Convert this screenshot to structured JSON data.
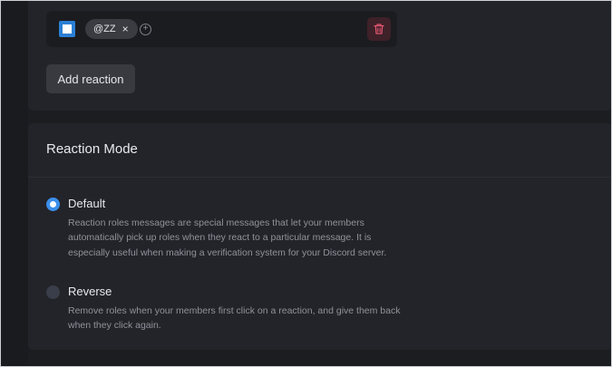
{
  "reaction": {
    "emoji_icon": "blue-square-emoji",
    "role_label": "@ZZ",
    "remove_role_glyph": "×",
    "add_role_glyph": "+",
    "delete_icon": "trash-icon"
  },
  "add_reaction_label": "Add reaction",
  "reaction_mode": {
    "title": "Reaction Mode",
    "options": [
      {
        "label": "Default",
        "selected": true,
        "description": "Reaction roles messages are special messages that let your members automatically pick up roles when they react to a particular message. It is especially useful when making a verification system for your Discord server."
      },
      {
        "label": "Reverse",
        "selected": false,
        "description": "Remove roles when your members first click on a reaction, and give them back when they click again."
      }
    ]
  },
  "colors": {
    "background": "#1c1d21",
    "card": "#232429",
    "accent": "#3b8eea",
    "danger": "#e0566f"
  }
}
